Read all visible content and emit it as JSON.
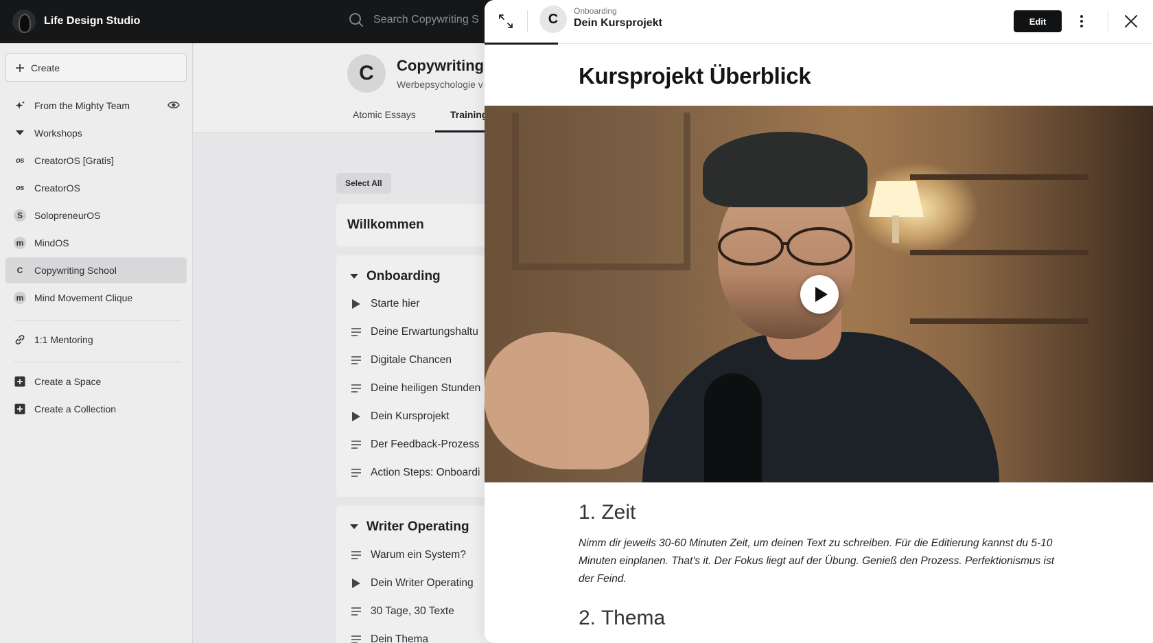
{
  "topbar": {
    "brand_name": "Life Design Studio",
    "search_placeholder": "Search Copywriting S"
  },
  "sidebar": {
    "create_label": "Create",
    "items": [
      {
        "label": "From the Mighty Team",
        "icon": "sparkle-icon"
      },
      {
        "label": "Workshops",
        "icon": "caret-down-icon"
      },
      {
        "label": "CreatorOS [Gratis]",
        "icon": "os-icon",
        "badge": "os"
      },
      {
        "label": "CreatorOS",
        "icon": "os-icon",
        "badge": "os"
      },
      {
        "label": "SolopreneurOS",
        "icon": "letter-avatar",
        "badge": "S"
      },
      {
        "label": "MindOS",
        "icon": "letter-avatar",
        "badge": "m"
      },
      {
        "label": "Copywriting School",
        "icon": "letter-avatar",
        "badge": "C",
        "active": true
      },
      {
        "label": "Mind Movement Clique",
        "icon": "letter-avatar",
        "badge": "m"
      },
      {
        "label": "1:1 Mentoring",
        "icon": "link-icon"
      },
      {
        "label": "Create a Space",
        "icon": "plus-square-icon"
      },
      {
        "label": "Create a Collection",
        "icon": "plus-square-icon"
      }
    ]
  },
  "space": {
    "avatar_letter": "C",
    "title": "Copywriting",
    "subtitle": "Werbepsychologie v",
    "tabs": [
      "Atomic Essays",
      "Training"
    ],
    "active_tab": "Training",
    "select_all_label": "Select All",
    "welcome_title": "Willkommen",
    "sections": [
      {
        "title": "Onboarding",
        "lessons": [
          {
            "label": "Starte hier",
            "type": "video"
          },
          {
            "label": "Deine Erwartungshaltu",
            "type": "text"
          },
          {
            "label": "Digitale Chancen",
            "type": "text"
          },
          {
            "label": "Deine heiligen Stunden",
            "type": "text"
          },
          {
            "label": "Dein Kursprojekt",
            "type": "video"
          },
          {
            "label": "Der Feedback-Prozess",
            "type": "text"
          },
          {
            "label": "Action Steps: Onboardi",
            "type": "text"
          }
        ]
      },
      {
        "title": "Writer Operating",
        "lessons": [
          {
            "label": "Warum ein System?",
            "type": "text"
          },
          {
            "label": "Dein Writer Operating",
            "type": "video"
          },
          {
            "label": "30 Tage, 30 Texte",
            "type": "text"
          },
          {
            "label": "Dein Thema",
            "type": "text"
          }
        ]
      }
    ]
  },
  "panel": {
    "avatar_letter": "C",
    "breadcrumb": "Onboarding",
    "title": "Dein Kursprojekt",
    "edit_label": "Edit",
    "post_title": "Kursprojekt Überblick",
    "heading_1": "1. Zeit",
    "paragraph_1": "Nimm dir jeweils 30-60 Minuten Zeit, um deinen Text zu schreiben. Für die Editierung kannst du 5-10 Minuten einplanen. That's it. Der Fokus liegt auf der Übung. Genieß den Prozess. Perfektionismus ist der Feind.",
    "heading_2": "2. Thema"
  }
}
